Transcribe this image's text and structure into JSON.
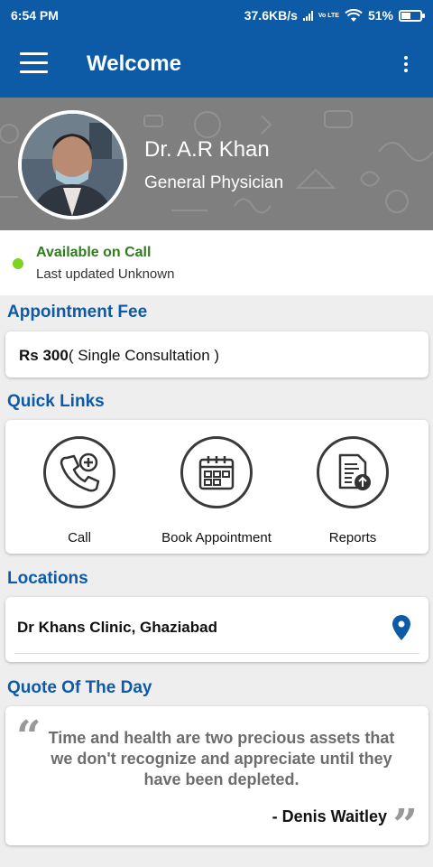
{
  "status_bar": {
    "time": "6:54 PM",
    "net_speed": "37.6KB/s",
    "volte": "Vo LTE",
    "battery": "51%",
    "battery_level": 0.51
  },
  "app_bar": {
    "title": "Welcome",
    "menu_icon": "hamburger-menu-icon",
    "overflow_icon": "more-vertical-icon"
  },
  "profile": {
    "name": "Dr. A.R Khan",
    "specialty": "General Physician",
    "avatar": "doctor-photo"
  },
  "availability": {
    "status": "Available on Call",
    "updated": "Last updated Unknown",
    "status_color": "#7dd321"
  },
  "appointment_fee": {
    "heading": "Appointment Fee",
    "amount": "Rs 300",
    "description": "( Single Consultation )"
  },
  "quick_links": {
    "heading": "Quick Links",
    "items": [
      {
        "label": "Call",
        "icon": "phone-plus-icon"
      },
      {
        "label": "Book Appointment",
        "icon": "calendar-icon"
      },
      {
        "label": "Reports",
        "icon": "report-upload-icon"
      }
    ]
  },
  "locations": {
    "heading": "Locations",
    "items": [
      {
        "name": "Dr Khans Clinic, Ghaziabad",
        "icon": "location-pin-icon"
      }
    ]
  },
  "quote": {
    "heading": "Quote Of The Day",
    "text": "Time and health are two precious assets that we don't recognize and appreciate until they have been depleted.",
    "author": "- Denis Waitley"
  },
  "colors": {
    "primary": "#0d5aa7",
    "accent_green": "#2e7d1b"
  }
}
